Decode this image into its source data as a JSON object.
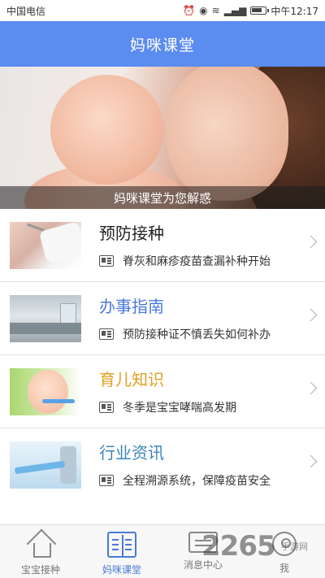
{
  "status_bar": {
    "carrier": "中国电信",
    "time": "中午12:17",
    "icons": [
      "alarm-icon",
      "eye-icon",
      "wifi-icon",
      "signal-icon",
      "battery-icon"
    ]
  },
  "header": {
    "title": "妈咪课堂"
  },
  "banner": {
    "caption": "妈咪课堂为您解惑"
  },
  "articles": [
    {
      "title": "预防接种",
      "subtitle": "脊灰和麻疹疫苗查漏补种开始",
      "title_color": "#222222"
    },
    {
      "title": "办事指南",
      "subtitle": "预防接种证不慎丢失如何补办",
      "title_color": "#4a79d8"
    },
    {
      "title": "育儿知识",
      "subtitle": "冬季是宝宝哮喘高发期",
      "title_color": "#e0a020"
    },
    {
      "title": "行业资讯",
      "subtitle": "全程溯源系统，保障疫苗安全",
      "title_color": "#3b87b8"
    }
  ],
  "bottom_nav": {
    "items": [
      {
        "label": "宝宝接种",
        "icon": "home-icon",
        "active": false
      },
      {
        "label": "妈咪课堂",
        "icon": "book-icon",
        "active": true
      },
      {
        "label": "消息中心",
        "icon": "message-icon",
        "active": false
      },
      {
        "label": "我",
        "icon": "person-icon",
        "active": false
      }
    ],
    "accent_color": "#4a79d8"
  },
  "watermark": {
    "text": "2265",
    "sub": "手游网"
  },
  "colors": {
    "header_bg": "#5b8cf0"
  }
}
